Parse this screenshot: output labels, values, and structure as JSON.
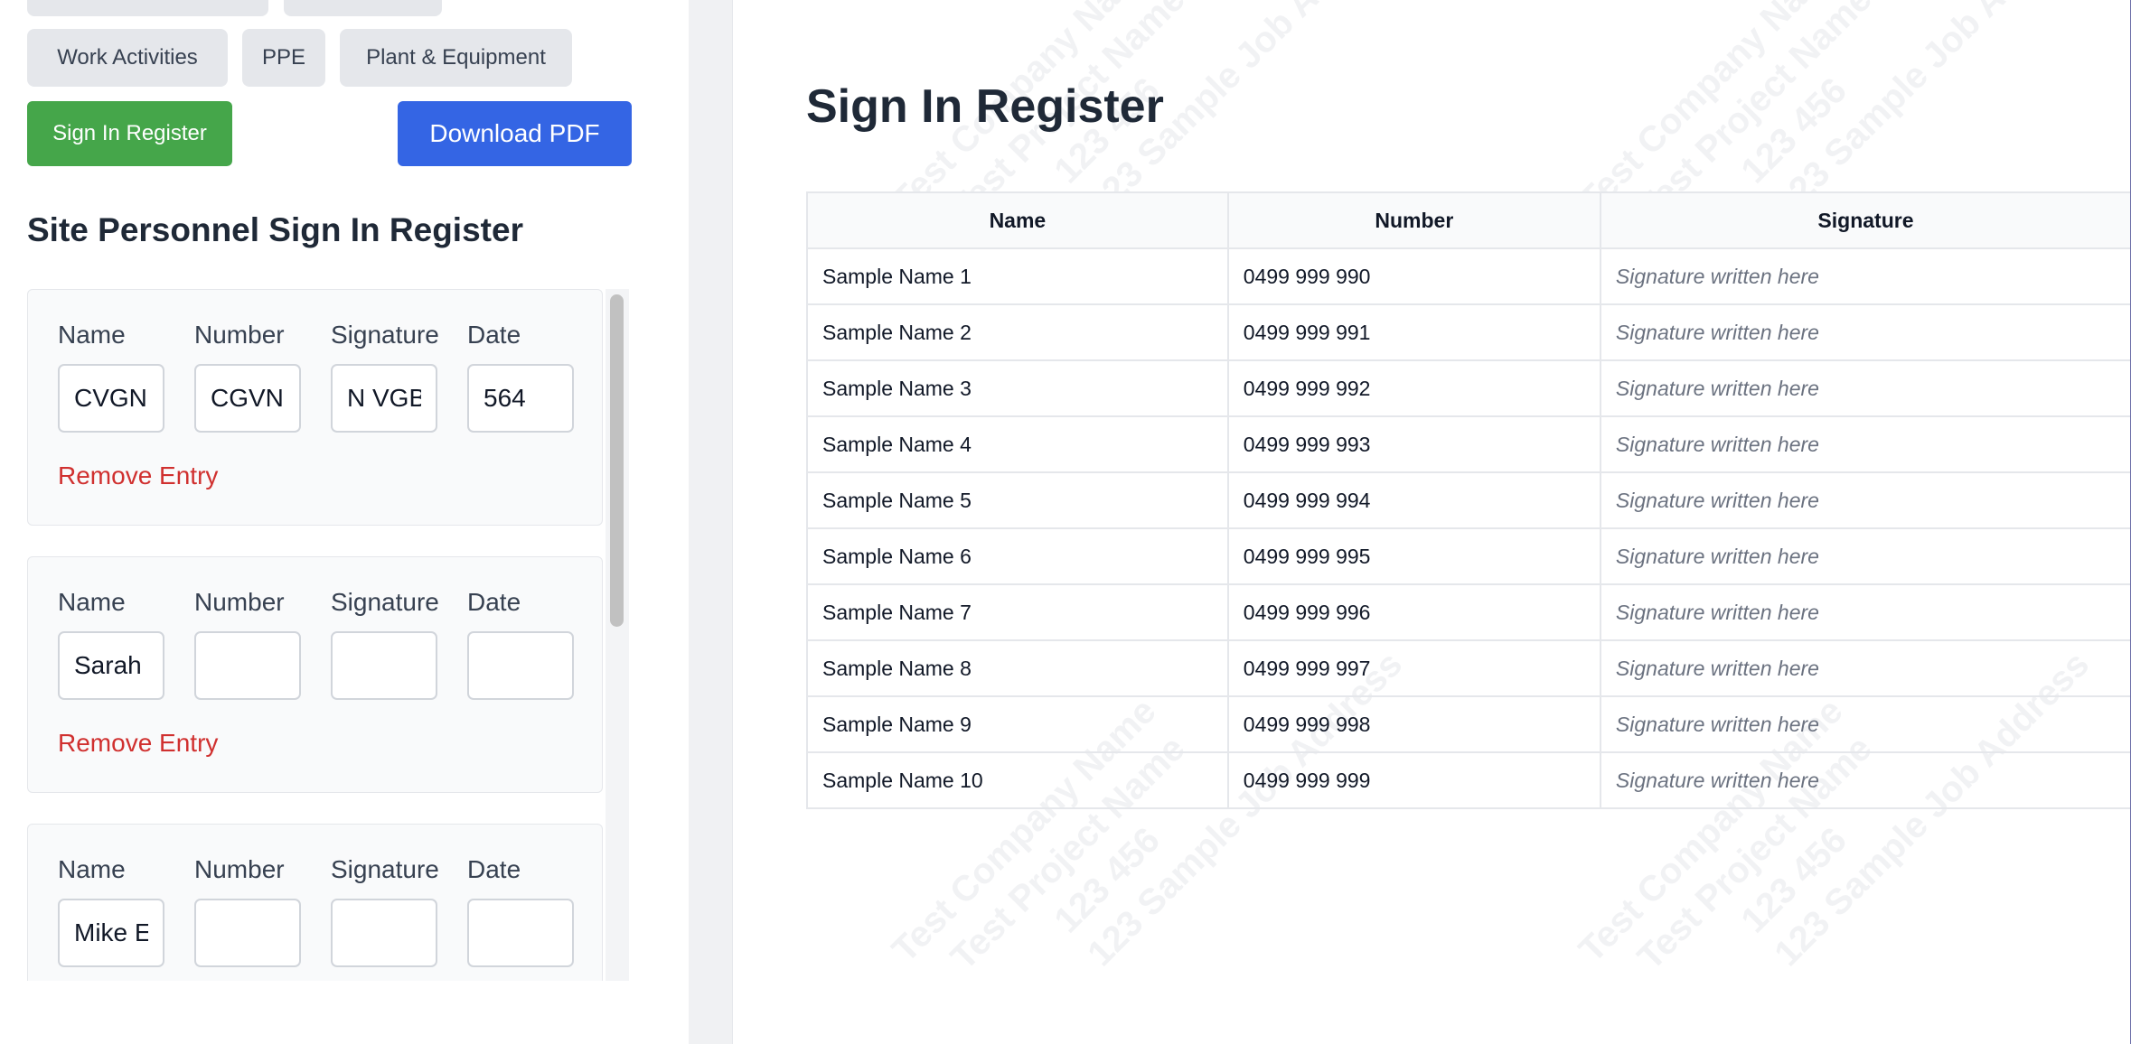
{
  "nav": {
    "work_activities": "Work Activities",
    "ppe": "PPE",
    "plant_equipment": "Plant & Equipment",
    "sign_in_register": "Sign In Register",
    "download_pdf": "Download PDF"
  },
  "form": {
    "title": "Site Personnel Sign In Register",
    "labels": {
      "name": "Name",
      "number": "Number",
      "signature": "Signature",
      "date": "Date"
    },
    "remove_label": "Remove Entry",
    "entries": [
      {
        "name": "CVGN",
        "number": "CGVN",
        "signature": "N VGB",
        "date": "564"
      },
      {
        "name": "Sarah",
        "number": "",
        "signature": "",
        "date": ""
      },
      {
        "name": "Mike E",
        "number": "",
        "signature": "",
        "date": ""
      }
    ]
  },
  "preview": {
    "title": "Sign In Register",
    "watermark": [
      "Test Company Name",
      "Test Project Name",
      "123 456",
      "123 Sample Job Address"
    ],
    "columns": [
      "Name",
      "Number",
      "Signature"
    ],
    "rows": [
      {
        "name": "Sample Name 1",
        "number": "0499 999 990",
        "signature": "Signature written here"
      },
      {
        "name": "Sample Name 2",
        "number": "0499 999 991",
        "signature": "Signature written here"
      },
      {
        "name": "Sample Name 3",
        "number": "0499 999 992",
        "signature": "Signature written here"
      },
      {
        "name": "Sample Name 4",
        "number": "0499 999 993",
        "signature": "Signature written here"
      },
      {
        "name": "Sample Name 5",
        "number": "0499 999 994",
        "signature": "Signature written here"
      },
      {
        "name": "Sample Name 6",
        "number": "0499 999 995",
        "signature": "Signature written here"
      },
      {
        "name": "Sample Name 7",
        "number": "0499 999 996",
        "signature": "Signature written here"
      },
      {
        "name": "Sample Name 8",
        "number": "0499 999 997",
        "signature": "Signature written here"
      },
      {
        "name": "Sample Name 9",
        "number": "0499 999 998",
        "signature": "Signature written here"
      },
      {
        "name": "Sample Name 10",
        "number": "0499 999 999",
        "signature": "Signature written here"
      }
    ]
  },
  "colors": {
    "sign_in_green": "#45a64a",
    "pdf_blue": "#3465e4",
    "remove_red": "#d0302f",
    "tab_gray": "#e5e7eb"
  }
}
